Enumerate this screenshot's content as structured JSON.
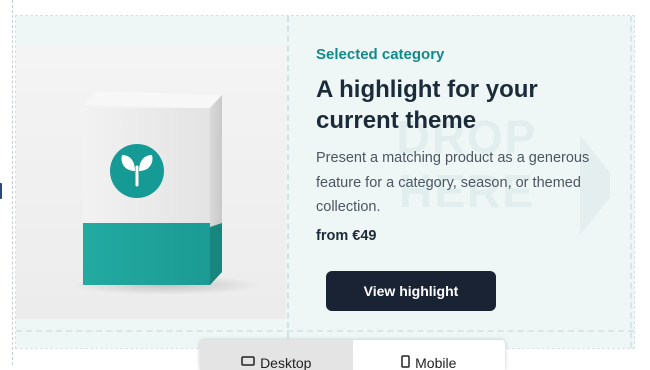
{
  "highlight": {
    "eyebrow": "Selected category",
    "title": "A highlight for your current theme",
    "description": "Present a matching product as a generous feature for a category, season, or themed collection.",
    "price": "from €49",
    "cta_label": "View highlight",
    "watermark": "DROP HERE",
    "accent_color": "#138a8a",
    "button_color": "#1a2333",
    "background_color": "#eef6f6"
  },
  "device_toggle": {
    "options": [
      {
        "label": "Desktop",
        "icon": "desktop-icon",
        "selected": false
      },
      {
        "label": "Mobile",
        "icon": "mobile-icon",
        "selected": true
      }
    ]
  }
}
